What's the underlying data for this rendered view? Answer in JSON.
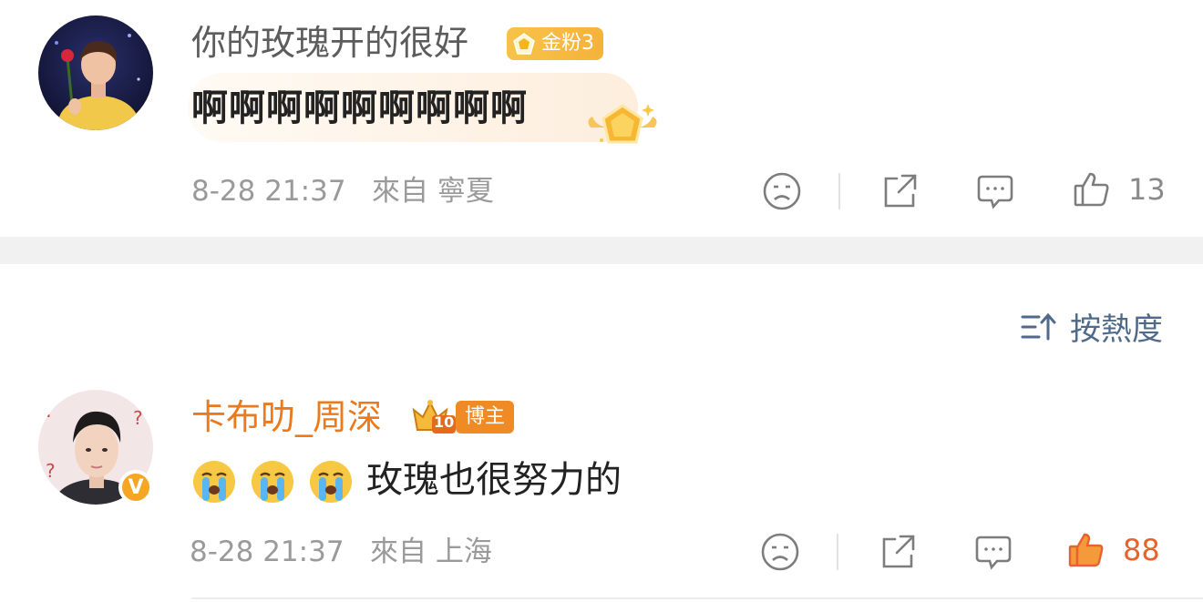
{
  "comments": [
    {
      "username": "你的玫瑰开的很好",
      "badge": "金粉3",
      "text": "啊啊啊啊啊啊啊啊啊",
      "date": "8-28 21:37",
      "source": "來自 寧夏",
      "like_count": "13",
      "liked": false
    },
    {
      "username": "卡布叻_周深",
      "badge": "博主",
      "crown_level": "10",
      "verified_mark": "V",
      "emoji_count": 3,
      "emoji_name": "crying-face",
      "text": "玫瑰也很努力的",
      "date": "8-28 21:37",
      "source": "來自 上海",
      "like_count": "88",
      "liked": true
    }
  ],
  "sort": {
    "label": "按熱度"
  },
  "icons": {
    "sad": "sad-face-icon",
    "share": "share-icon",
    "comment": "comment-icon",
    "like": "thumbs-up-icon",
    "sort": "sort-icon"
  },
  "colors": {
    "username_gray": "#5c5c5c",
    "username_orange": "#eb7a1e",
    "meta": "#9a9a9a",
    "liked": "#e8632b",
    "sort": "#506a8a",
    "fan_badge": "#f6b23a",
    "blogger_badge": "#f08a24"
  }
}
